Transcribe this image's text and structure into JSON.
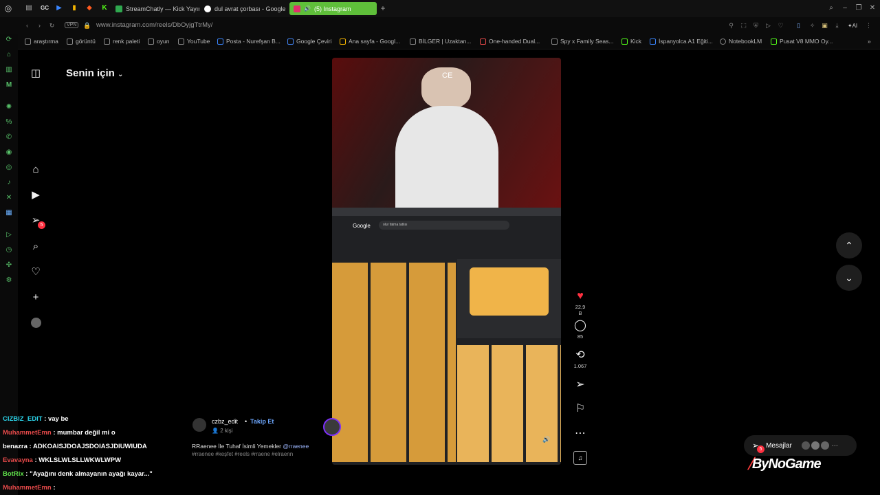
{
  "browser": {
    "tabs": [
      {
        "label": "StreamChatly — Kick Yayın...",
        "color": "#2fa84f"
      },
      {
        "label": "dul avrat çorbası - Google ...",
        "color": "#4285f4"
      },
      {
        "label": "(5) Instagram",
        "color": "#e1306c",
        "active": true
      }
    ],
    "pinned_labels": [
      "GC"
    ],
    "address": {
      "vpn_label": "VPN",
      "url": "www.instagram.com/reels/DbOyjgTtrMy/"
    },
    "ai_label": "AI",
    "bookmarks": [
      {
        "label": "araştırma",
        "icon": "folder-icon"
      },
      {
        "label": "görüntü",
        "icon": "folder-icon"
      },
      {
        "label": "renk paleti",
        "icon": "folder-icon"
      },
      {
        "label": "oyun",
        "icon": "folder-icon"
      },
      {
        "label": "YouTube",
        "icon": "page-icon"
      },
      {
        "label": "Posta - Nurefşan B...",
        "icon": "mail-icon"
      },
      {
        "label": "Google Çeviri",
        "icon": "translate-icon"
      },
      {
        "label": "Ana sayfa - Googl...",
        "icon": "drive-icon"
      },
      {
        "label": "BİLGER | Uzaktan...",
        "icon": "page-icon"
      },
      {
        "label": "One-handed Dual...",
        "icon": "page-icon"
      },
      {
        "label": "Spy x Family Seas...",
        "icon": "page-icon"
      },
      {
        "label": "Kick",
        "icon": "kick-icon"
      },
      {
        "label": "İspanyolca A1 Eğiti...",
        "icon": "page-icon"
      },
      {
        "label": "NotebookLM",
        "icon": "notebook-icon"
      },
      {
        "label": "Pusat V8 MMO Oy...",
        "icon": "page-icon"
      }
    ]
  },
  "instagram": {
    "feed_title": "Senin için",
    "nav_badge": "5",
    "reel": {
      "author": "czbz_edit",
      "follow_label": "Takip Et",
      "audience": "2 kişi",
      "caption_text": "RRaenee İle Tuhaf İsimli Yemekler",
      "caption_mention": "@rraenee",
      "hashtags": "#rraenee #keşfet #reels #rraene #elraenn",
      "watermark": "CE",
      "likes": "22,9 B",
      "comments": "85",
      "reposts": "1.067",
      "inner_search_query": "olur fatma tatlısı",
      "inner_google_logo": "Google"
    },
    "messages_label": "Mesajlar",
    "messages_badge": "5"
  },
  "chat": [
    {
      "user": "CIZBIZ_EDIT",
      "text": ": vay be",
      "color": "#2bd2e8"
    },
    {
      "user": "MuhammetEmn",
      "text": ": mumbar değil mi o",
      "color": "#e84a4a"
    },
    {
      "user": "benazra",
      "text": ": ADKOAISJDOAJSDOIASJDIUWIUDA",
      "color": "#ffffff"
    },
    {
      "user": "Evavayna",
      "text": ": WKLSLWLSLLWKWLWPW",
      "color": "#e84a4a"
    },
    {
      "user": "BotRix",
      "text": ": \"Ayağını denk almayanın ayağı kayar...\"",
      "color": "#5fe04a"
    },
    {
      "user": "MuhammetEmn",
      "text": ":",
      "color": "#e84a4a"
    }
  ],
  "overlay_brand": "ByNoGame"
}
